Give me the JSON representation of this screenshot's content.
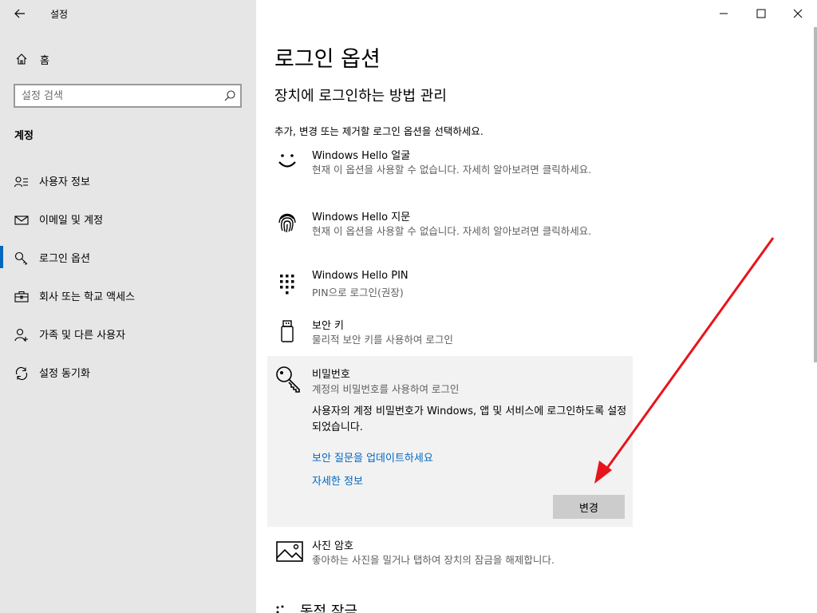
{
  "app": {
    "title": "설정"
  },
  "sidebar": {
    "home_label": "홈",
    "search_placeholder": "설정 검색",
    "section_label": "계정",
    "items": [
      {
        "label": "사용자 정보",
        "icon": "user-info-icon"
      },
      {
        "label": "이메일 및 계정",
        "icon": "mail-icon"
      },
      {
        "label": "로그인 옵션",
        "icon": "key-icon",
        "active": true
      },
      {
        "label": "회사 또는 학교 액세스",
        "icon": "briefcase-icon"
      },
      {
        "label": "가족 및 다른 사용자",
        "icon": "person-add-icon"
      },
      {
        "label": "설정 동기화",
        "icon": "sync-icon"
      }
    ]
  },
  "main": {
    "title": "로그인 옵션",
    "subtitle": "장치에 로그인하는 방법 관리",
    "instruction": "추가, 변경 또는 제거할 로그인 옵션을 선택하세요.",
    "options": [
      {
        "title": "Windows Hello 얼굴",
        "desc": "현재 이 옵션을 사용할 수 없습니다. 자세히 알아보려면 클릭하세요.",
        "icon": "face-icon"
      },
      {
        "title": "Windows Hello 지문",
        "desc": "현재 이 옵션을 사용할 수 없습니다. 자세히 알아보려면 클릭하세요.",
        "icon": "fingerprint-icon"
      },
      {
        "title": "Windows Hello PIN",
        "desc": "PIN으로 로그인(권장)",
        "icon": "pin-keypad-icon"
      },
      {
        "title": "보안 키",
        "desc": "물리적 보안 키를 사용하여 로그인",
        "icon": "usb-key-icon"
      }
    ],
    "password": {
      "title": "비밀번호",
      "desc": "계정의 비밀번호를 사용하여 로그인",
      "body": "사용자의 계정 비밀번호가 Windows, 앱 및 서비스에 로그인하도록 설정되었습니다.",
      "link_update": "보안 질문을 업데이트하세요",
      "link_more": "자세한 정보",
      "change_button": "변경"
    },
    "picture_password": {
      "title": "사진 암호",
      "desc": "좋아하는 사진을 밀거나 탭하여 장치의 잠금을 해제합니다."
    },
    "partial_section": "동적 잠금"
  },
  "colors": {
    "accent": "#0067c0",
    "arrow": "#e8141b"
  }
}
